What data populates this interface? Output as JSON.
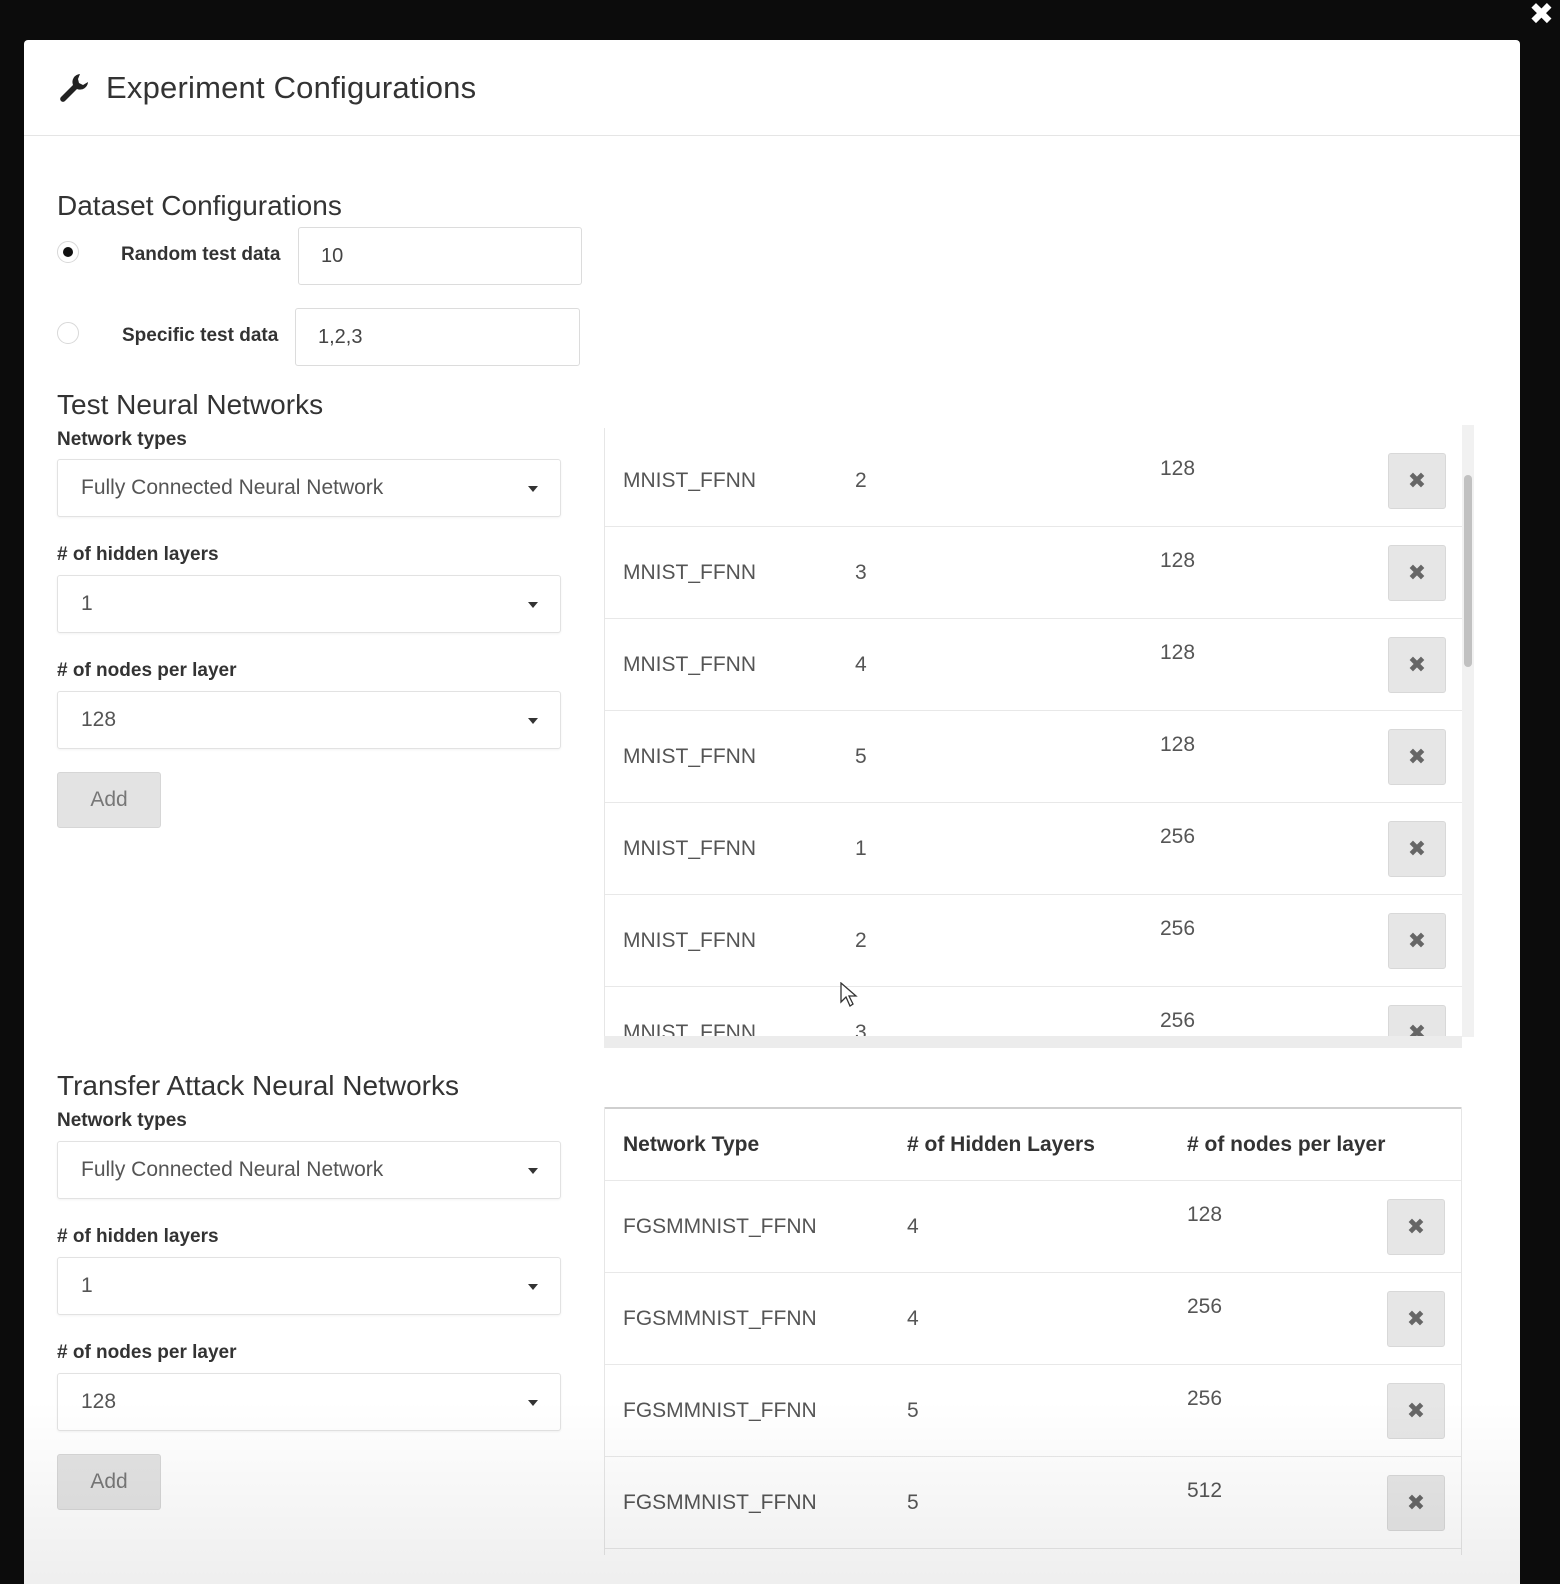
{
  "modal": {
    "title": "Experiment Configurations",
    "close_glyph": "✖",
    "title_icon": "wrench-icon"
  },
  "dataset": {
    "title": "Dataset Configurations",
    "random": {
      "label": "Random test data",
      "value": "10",
      "selected": true
    },
    "specific": {
      "label": "Specific test data",
      "value": "1,2,3",
      "selected": false
    }
  },
  "test_nn": {
    "title": "Test Neural Networks",
    "network_types_label": "Network types",
    "network_type_value": "Fully Connected Neural Network",
    "hidden_layers_label": "# of hidden layers",
    "hidden_layers_value": "1",
    "nodes_label": "# of nodes per layer",
    "nodes_value": "128",
    "add_label": "Add",
    "rows": [
      {
        "type": "MNIST_FFNN",
        "layers": "2",
        "nodes": "128"
      },
      {
        "type": "MNIST_FFNN",
        "layers": "3",
        "nodes": "128"
      },
      {
        "type": "MNIST_FFNN",
        "layers": "4",
        "nodes": "128"
      },
      {
        "type": "MNIST_FFNN",
        "layers": "5",
        "nodes": "128"
      },
      {
        "type": "MNIST_FFNN",
        "layers": "1",
        "nodes": "256"
      },
      {
        "type": "MNIST_FFNN",
        "layers": "2",
        "nodes": "256"
      },
      {
        "type": "MNIST_FFNN",
        "layers": "3",
        "nodes": "256"
      }
    ]
  },
  "transfer_nn": {
    "title": "Transfer Attack Neural Networks",
    "network_types_label": "Network types",
    "network_type_value": "Fully Connected Neural Network",
    "hidden_layers_label": "# of hidden layers",
    "hidden_layers_value": "1",
    "nodes_label": "# of nodes per layer",
    "nodes_value": "128",
    "add_label": "Add",
    "columns": [
      "Network Type",
      "# of Hidden Layers",
      "# of nodes per layer"
    ],
    "rows": [
      {
        "type": "FGSMMNIST_FFNN",
        "layers": "4",
        "nodes": "128"
      },
      {
        "type": "FGSMMNIST_FFNN",
        "layers": "4",
        "nodes": "256"
      },
      {
        "type": "FGSMMNIST_FFNN",
        "layers": "5",
        "nodes": "256"
      },
      {
        "type": "FGSMMNIST_FFNN",
        "layers": "5",
        "nodes": "512"
      }
    ]
  },
  "delete_glyph": "✖"
}
